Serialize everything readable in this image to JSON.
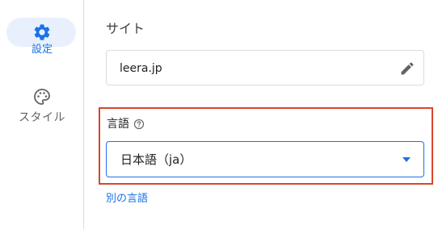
{
  "sidebar": {
    "items": [
      {
        "label": "設定",
        "icon": "gear-icon",
        "active": true
      },
      {
        "label": "スタイル",
        "icon": "palette-icon",
        "active": false
      }
    ]
  },
  "site": {
    "heading": "サイト",
    "value": "leera.jp",
    "edit_icon": "pencil-icon"
  },
  "language": {
    "label": "言語",
    "help_icon": "help-circle-icon",
    "selected": "日本語（ja）",
    "dropdown_icon": "triangle-down-icon",
    "other_link": "別の言語"
  },
  "colors": {
    "accent": "#1a73e8",
    "active_pill": "#e8f0fe",
    "highlight_border": "#d9452b",
    "field_border": "#dadce0"
  }
}
